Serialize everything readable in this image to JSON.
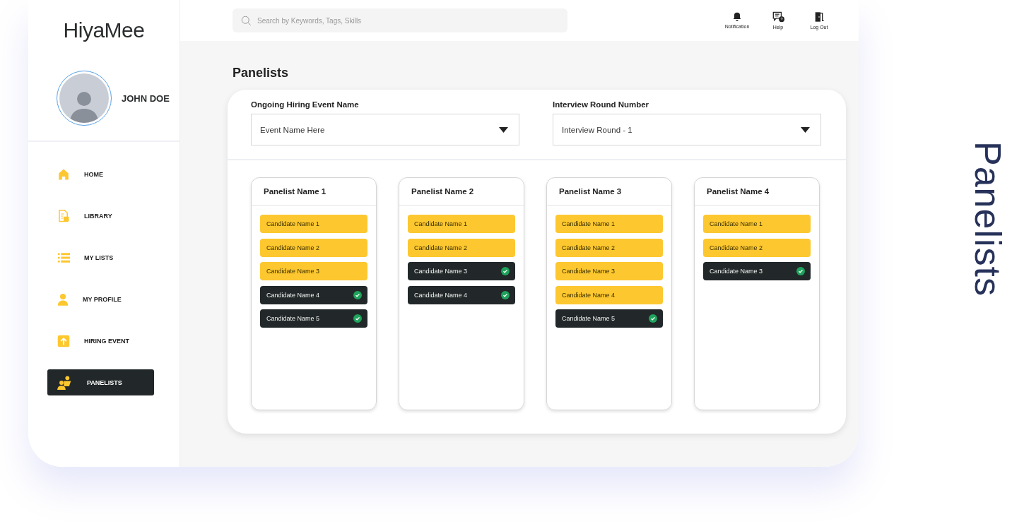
{
  "logo": "HiyaMee",
  "user": {
    "name": "JOHN DOE"
  },
  "sidebar": {
    "items": [
      {
        "label": "HOME",
        "kind": "home",
        "selected": false
      },
      {
        "label": "LIBRARY",
        "kind": "library",
        "selected": false
      },
      {
        "label": "MY LISTS",
        "kind": "lists",
        "selected": false
      },
      {
        "label": "MY PROFILE",
        "kind": "profile",
        "selected": false
      },
      {
        "label": "HIRING EVENT",
        "kind": "event",
        "selected": false
      },
      {
        "label": "PANELISTS",
        "kind": "panelists",
        "selected": true
      }
    ]
  },
  "search": {
    "placeholder": "Search by Keywords, Tags, Skills"
  },
  "top_actions": [
    {
      "label": "Notification",
      "kind": "bell"
    },
    {
      "label": "Help",
      "kind": "help"
    },
    {
      "label": "Log Out",
      "kind": "logout"
    }
  ],
  "page_title": "Panelists",
  "filters": [
    {
      "label": "Ongoing Hiring Event Name",
      "value": "Event Name Here"
    },
    {
      "label": "Interview Round Number",
      "value": "Interview Round - 1"
    }
  ],
  "panelists": [
    {
      "name": "Panelist Name 1",
      "candidates": [
        {
          "name": "Candidate Name 1",
          "done": false
        },
        {
          "name": "Candidate Name 2",
          "done": false
        },
        {
          "name": "Candidate Name 3",
          "done": false
        },
        {
          "name": "Candidate Name 4",
          "done": true
        },
        {
          "name": "Candidate Name 5",
          "done": true
        }
      ]
    },
    {
      "name": "Panelist Name 2",
      "candidates": [
        {
          "name": "Candidate Name 1",
          "done": false
        },
        {
          "name": "Candidate Name 2",
          "done": false
        },
        {
          "name": "Candidate Name 3",
          "done": true
        },
        {
          "name": "Candidate Name 4",
          "done": true
        }
      ]
    },
    {
      "name": "Panelist Name 3",
      "candidates": [
        {
          "name": "Candidate Name 1",
          "done": false
        },
        {
          "name": "Candidate Name 2",
          "done": false
        },
        {
          "name": "Candidate Name 3",
          "done": false
        },
        {
          "name": "Candidate Name 4",
          "done": false
        },
        {
          "name": "Candidate Name 5",
          "done": true
        }
      ]
    },
    {
      "name": "Panelist Name 4",
      "candidates": [
        {
          "name": "Candidate Name 1",
          "done": false
        },
        {
          "name": "Candidate Name 2",
          "done": false
        },
        {
          "name": "Candidate Name 3",
          "done": true
        }
      ]
    }
  ],
  "side_caption": "Panelists"
}
